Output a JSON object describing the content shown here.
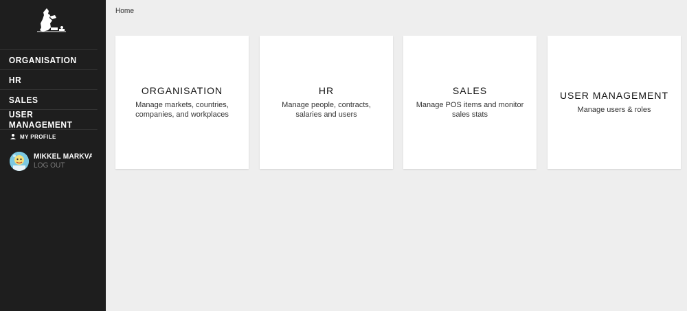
{
  "sidebar": {
    "logo_icon": "silhouette-logo-icon",
    "nav_items": [
      {
        "label": "ORGANISATION"
      },
      {
        "label": "HR"
      },
      {
        "label": "SALES"
      },
      {
        "label": "USER MANAGEMENT"
      }
    ],
    "profile_link": {
      "label": "MY PROFILE",
      "icon": "person-icon"
    },
    "user": {
      "name": "MIKKEL MARKVARD..",
      "logout_label": "LOG OUT",
      "avatar": "avatar-image"
    }
  },
  "breadcrumb": "Home",
  "cards": [
    {
      "title": "ORGANISATION",
      "description": "Manage markets, countries, companies, and workplaces"
    },
    {
      "title": "HR",
      "description": "Manage people, contracts, salaries and users"
    },
    {
      "title": "SALES",
      "description": "Manage POS items and monitor sales stats"
    },
    {
      "title": "USER MANAGEMENT",
      "description": "Manage users & roles"
    }
  ],
  "colors": {
    "sidebar_bg": "#1e1e1e",
    "main_bg": "#eeeeee",
    "card_bg": "#ffffff",
    "logout_text": "#7a7a7a"
  }
}
